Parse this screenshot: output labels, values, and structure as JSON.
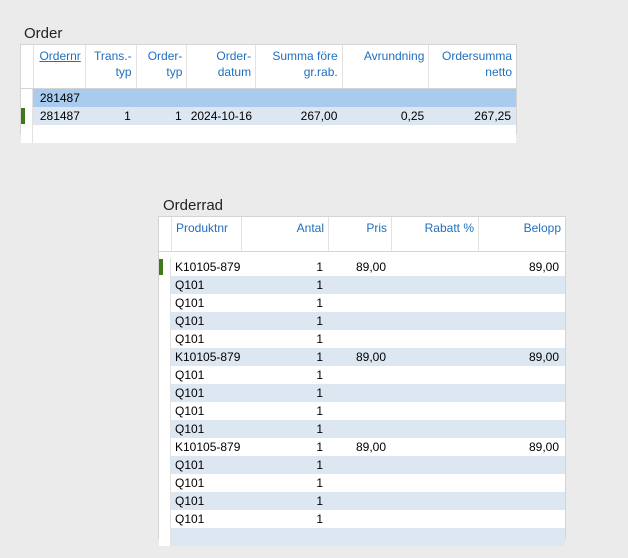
{
  "order": {
    "title": "Order",
    "columns": [
      "Ordernr",
      "Trans.-\ntyp",
      "Order-\ntyp",
      "Order-\ndatum",
      "Summa före\ngr.rab.",
      "Avrundning",
      "Ordersumma\nnetto"
    ],
    "rows": [
      [
        "281487",
        "",
        "",
        "",
        "",
        "",
        ""
      ],
      [
        "281487",
        "1",
        "1",
        "2024-10-16",
        "267,00",
        "0,25",
        "267,25"
      ]
    ]
  },
  "orderrad": {
    "title": "Orderrad",
    "columns": [
      "Produktnr",
      "Antal",
      "Pris",
      "Rabatt %",
      "Belopp"
    ],
    "rows": [
      [
        "K10105-879",
        "1",
        "89,00",
        "",
        "89,00"
      ],
      [
        "Q101",
        "1",
        "",
        "",
        ""
      ],
      [
        "Q101",
        "1",
        "",
        "",
        ""
      ],
      [
        "Q101",
        "1",
        "",
        "",
        ""
      ],
      [
        "Q101",
        "1",
        "",
        "",
        ""
      ],
      [
        "K10105-879",
        "1",
        "89,00",
        "",
        "89,00"
      ],
      [
        "Q101",
        "1",
        "",
        "",
        ""
      ],
      [
        "Q101",
        "1",
        "",
        "",
        ""
      ],
      [
        "Q101",
        "1",
        "",
        "",
        ""
      ],
      [
        "Q101",
        "1",
        "",
        "",
        ""
      ],
      [
        "K10105-879",
        "1",
        "89,00",
        "",
        "89,00"
      ],
      [
        "Q101",
        "1",
        "",
        "",
        ""
      ],
      [
        "Q101",
        "1",
        "",
        "",
        ""
      ],
      [
        "Q101",
        "1",
        "",
        "",
        ""
      ],
      [
        "Q101",
        "1",
        "",
        "",
        ""
      ]
    ]
  }
}
